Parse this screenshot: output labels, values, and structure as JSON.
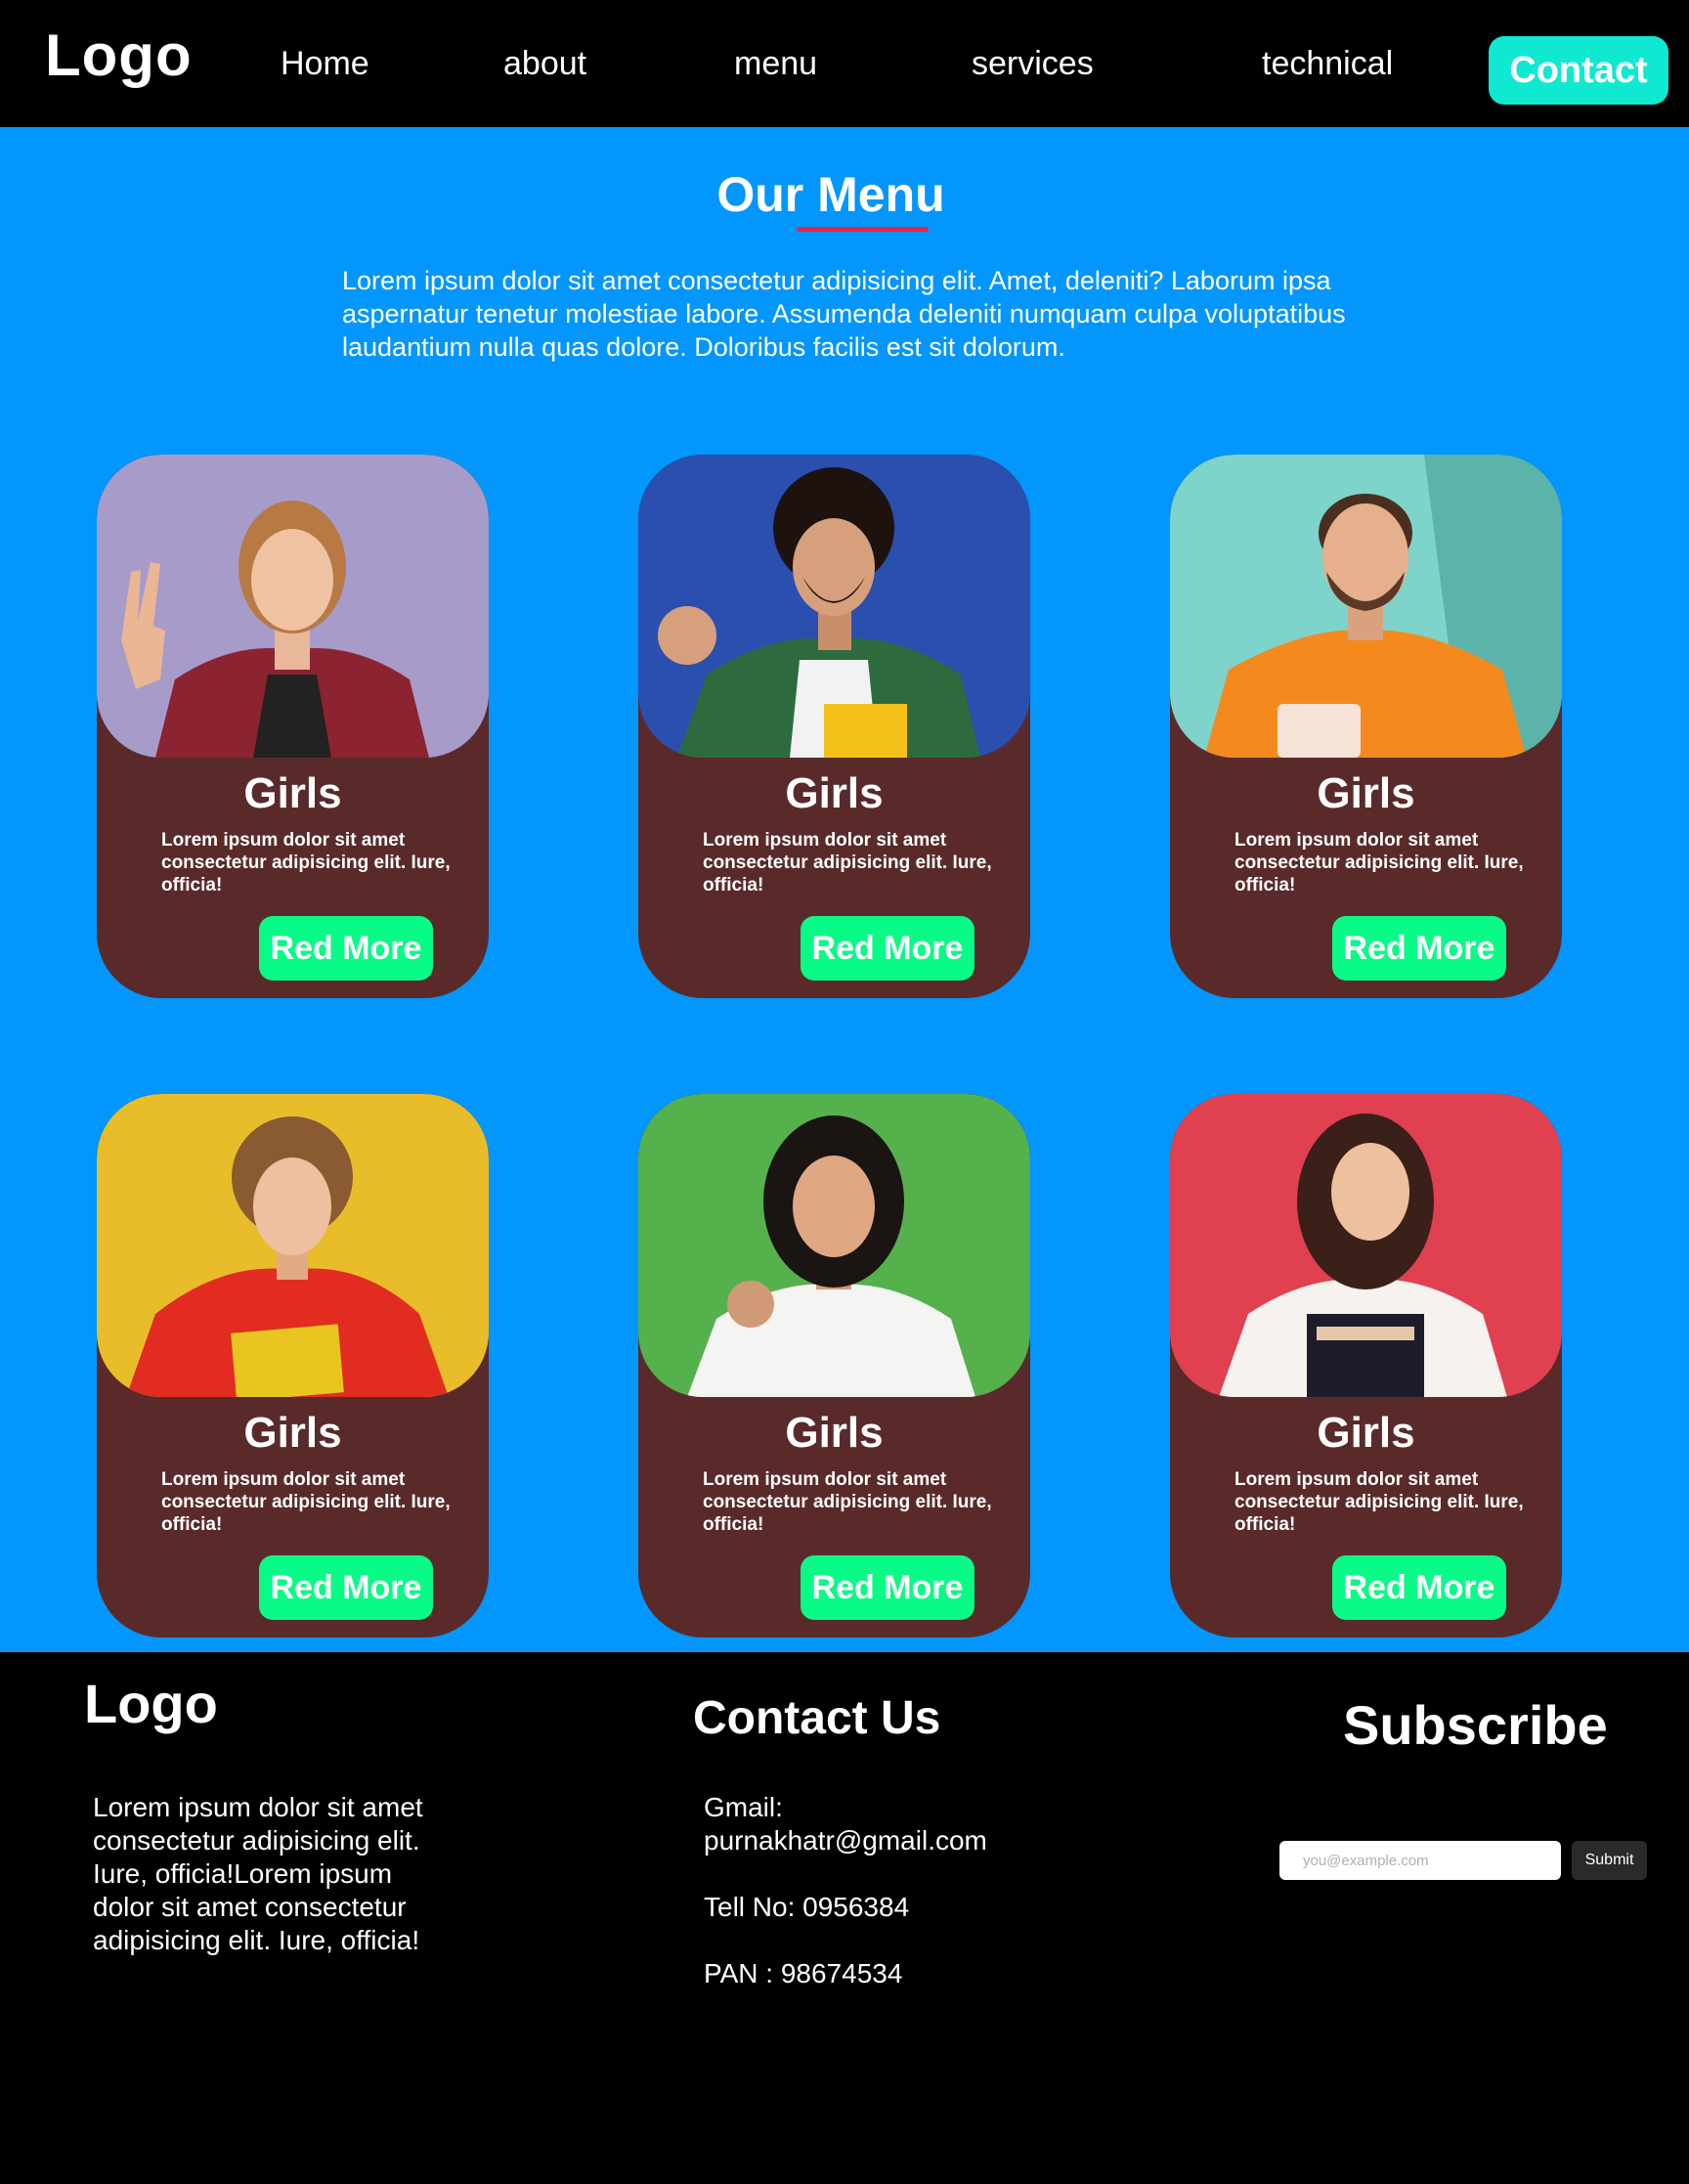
{
  "header": {
    "logo": "Logo",
    "nav": [
      {
        "label": "Home"
      },
      {
        "label": "about"
      },
      {
        "label": "menu"
      },
      {
        "label": "services"
      },
      {
        "label": "technical"
      }
    ],
    "contact_label": "Contact"
  },
  "menu": {
    "title": "Our Menu",
    "intro": "Lorem ipsum dolor sit amet consectetur adipisicing elit. Amet, deleniti? Laborum ipsa aspernatur tenetur molestiae labore. Assumenda deleniti numquam culpa voluptatibus laudantium nulla quas dolore. Doloribus facilis est sit dolorum.",
    "cards": [
      {
        "title": "Girls",
        "text": "Lorem ipsum dolor sit amet consectetur adipisicing elit. Iure, officia!",
        "button": "Red More",
        "photo_bg": "#a79bc9"
      },
      {
        "title": "Girls",
        "text": "Lorem ipsum dolor sit amet consectetur adipisicing elit. Iure, officia!",
        "button": "Red More",
        "photo_bg": "#2a4fae"
      },
      {
        "title": "Girls",
        "text": "Lorem ipsum dolor sit amet consectetur adipisicing elit. Iure, officia!",
        "button": "Red More",
        "photo_bg": "#7ed3cb"
      },
      {
        "title": "Girls",
        "text": "Lorem ipsum dolor sit amet consectetur adipisicing elit. Iure, officia!",
        "button": "Red More",
        "photo_bg": "#e9bd2a"
      },
      {
        "title": "Girls",
        "text": "Lorem ipsum dolor sit amet consectetur adipisicing elit. Iure, officia!",
        "button": "Red More",
        "photo_bg": "#55b14c"
      },
      {
        "title": "Girls",
        "text": "Lorem ipsum dolor sit amet consectetur adipisicing elit. Iure, officia!",
        "button": "Red More",
        "photo_bg": "#e04050"
      }
    ]
  },
  "footer": {
    "logo": "Logo",
    "about": "Lorem ipsum dolor sit amet consectetur adipisicing elit. Iure, officia!Lorem ipsum dolor sit amet consectetur adipisicing elit. Iure, officia!",
    "contact_title": "Contact Us",
    "gmail_label": "Gmail:",
    "gmail": "purnakhatr@gmail.com",
    "tel": "Tell No: 0956384",
    "pan": "PAN : 98674534",
    "subscribe_title": "Subscribe",
    "subscribe_placeholder": "you@example.com",
    "subscribe_button": "Submit"
  },
  "colors": {
    "main_bg": "#0396fd",
    "card_bg": "#5a2a2a",
    "button_green": "#08fb86",
    "contact_cyan": "#0fe9d2",
    "underline_red": "#e8234a"
  }
}
